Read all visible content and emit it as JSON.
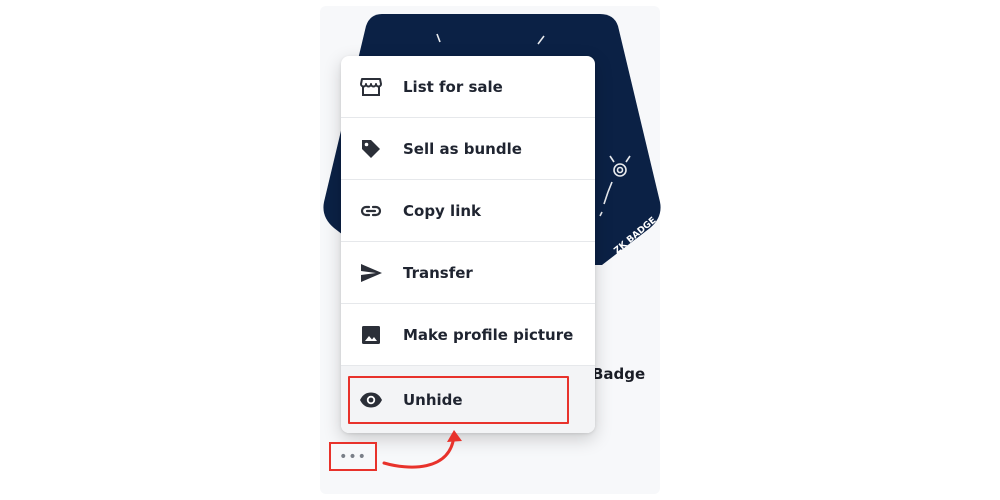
{
  "card": {
    "title": "Badge"
  },
  "badge": {
    "text": "ZK BADGE"
  },
  "menu": {
    "items": [
      {
        "label": "List for sale",
        "icon": "storefront-icon"
      },
      {
        "label": "Sell as bundle",
        "icon": "tag-icon"
      },
      {
        "label": "Copy link",
        "icon": "link-icon"
      },
      {
        "label": "Transfer",
        "icon": "send-icon"
      },
      {
        "label": "Make profile picture",
        "icon": "image-icon"
      },
      {
        "label": "Unhide",
        "icon": "eye-icon"
      }
    ]
  },
  "more_button": {
    "label": "•••"
  },
  "colors": {
    "highlight": "#e8322b",
    "badge": "#0b2145",
    "text": "#1f2430"
  }
}
